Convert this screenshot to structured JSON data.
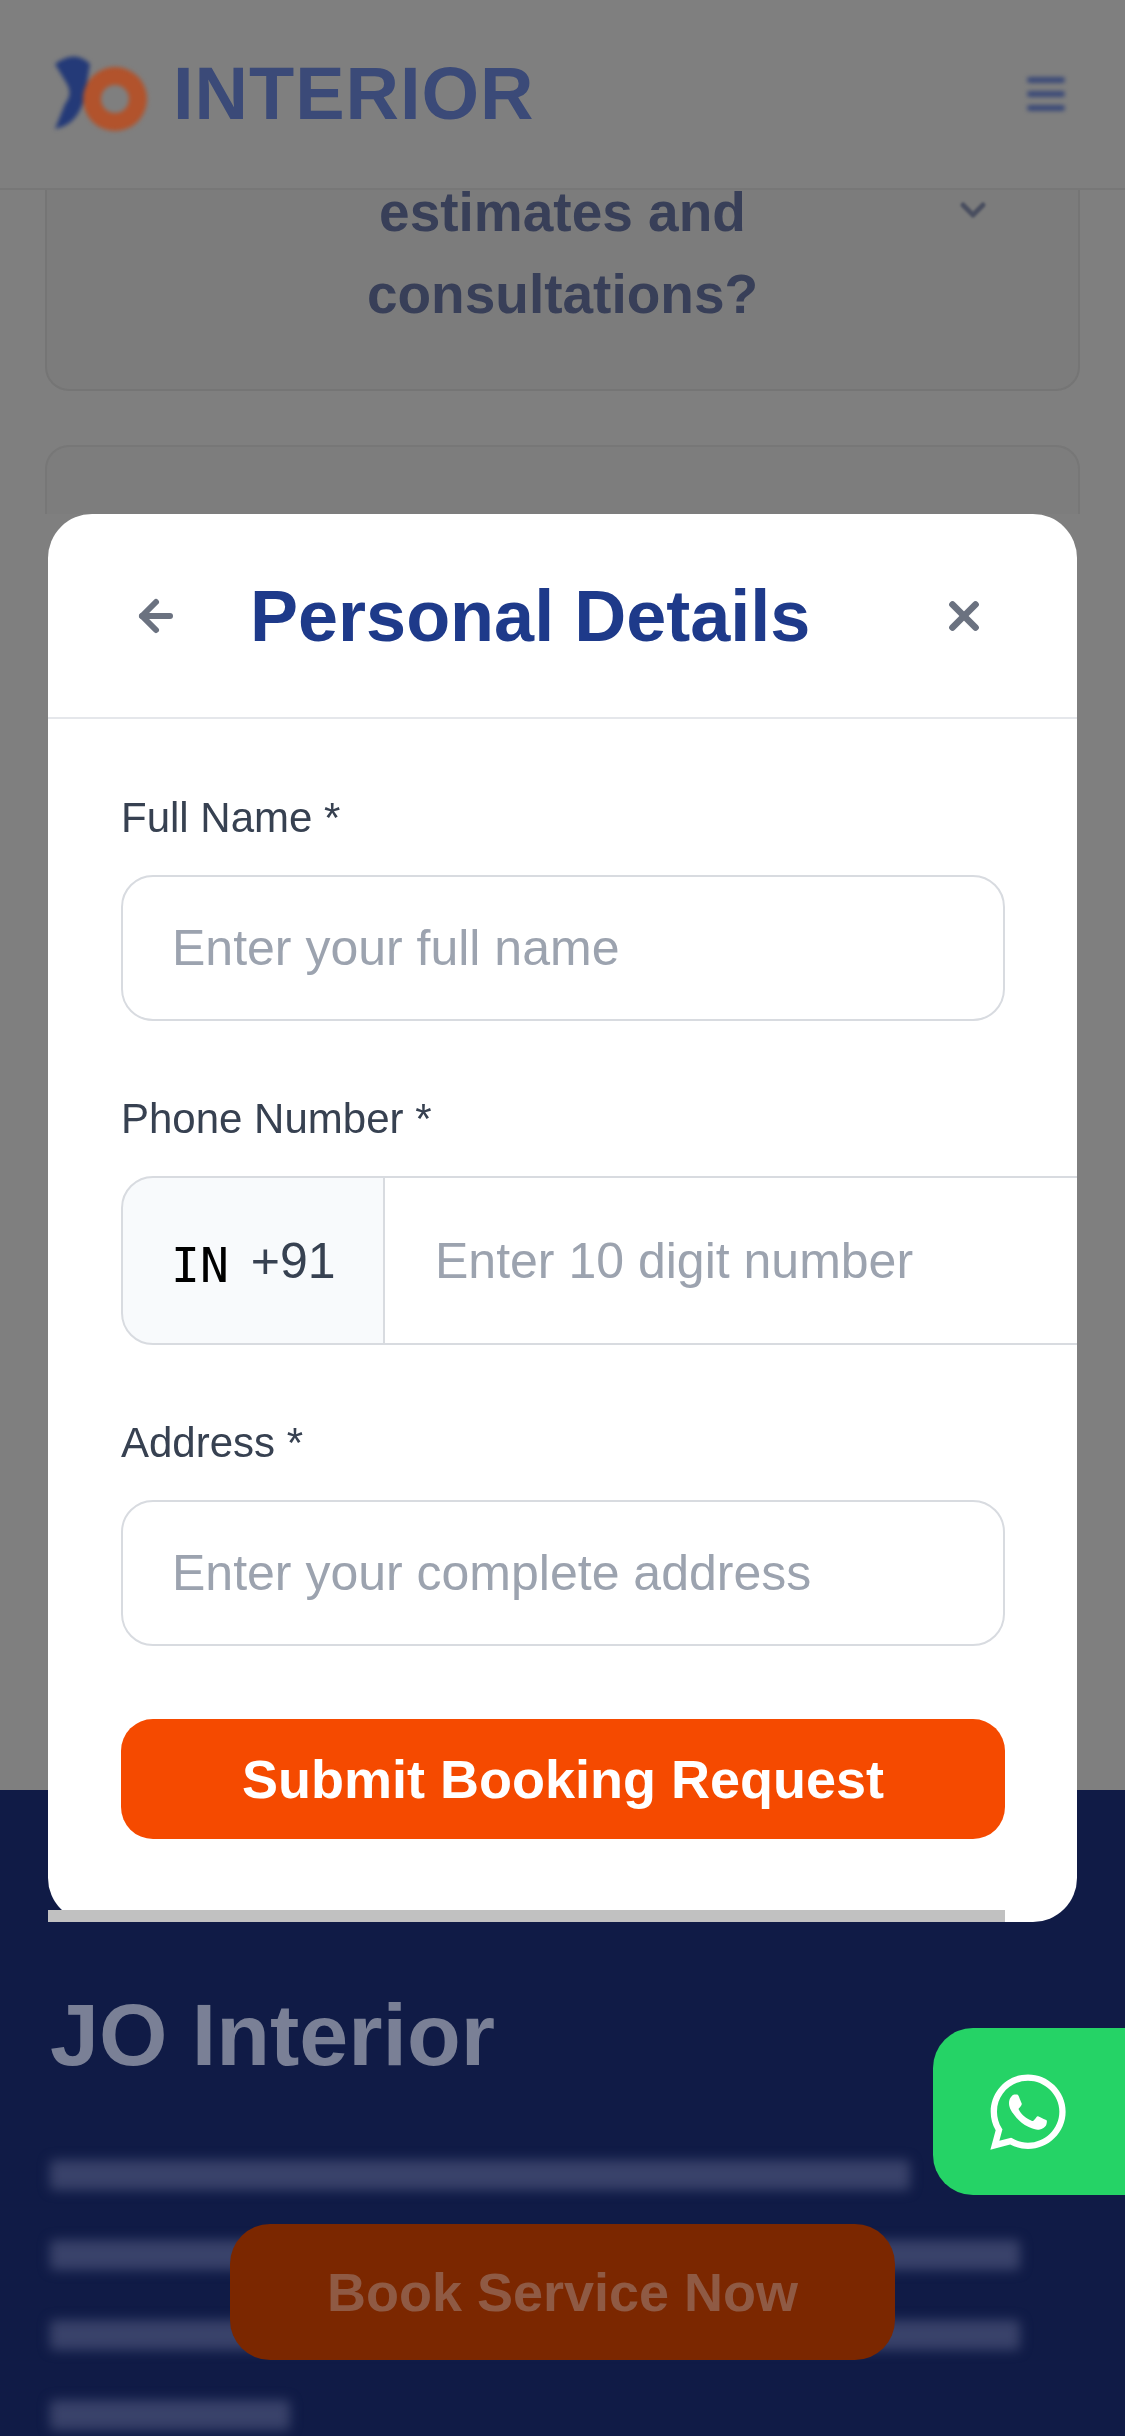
{
  "header": {
    "logo_text": "INTERIOR"
  },
  "faq_item": {
    "question": "estimates and consultations?"
  },
  "modal": {
    "title": "Personal Details",
    "fields": [
      {
        "kind": "text",
        "label": "Full Name *",
        "placeholder": "Enter your full name"
      },
      {
        "kind": "phone",
        "label": "Phone Number *",
        "country": "IN",
        "dial_code": "+91",
        "placeholder": "Enter 10 digit number"
      },
      {
        "kind": "text",
        "label": "Address *",
        "placeholder": "Enter your complete address"
      }
    ],
    "submit_button": "Submit Booking Request"
  },
  "footer": {
    "brand": "JO Interior",
    "book_button": "Book Service Now"
  }
}
